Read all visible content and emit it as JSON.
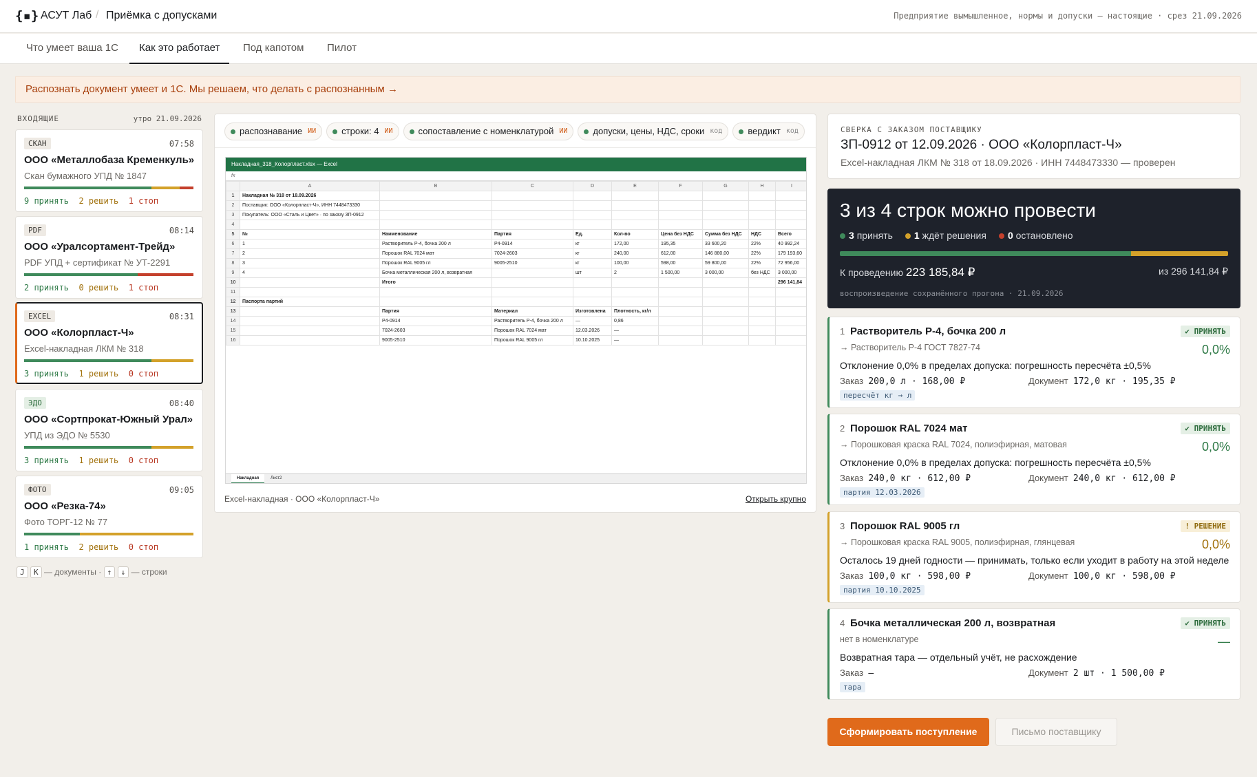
{
  "app": {
    "logo": "{▪}",
    "name": "АСУТ Лаб",
    "breadcrumb": "Приёмка с допусками",
    "note": "Предприятие вымышленное, нормы и допуски — настоящие · срез 21.09.2026"
  },
  "tabs": [
    {
      "label": "Что умеет ваша 1С",
      "active": false
    },
    {
      "label": "Как это работает",
      "active": true
    },
    {
      "label": "Под капотом",
      "active": false
    },
    {
      "label": "Пилот",
      "active": false
    }
  ],
  "banner": "Распознать документ умеет и 1С. Мы решаем, что делать с распознанным →",
  "inbox": {
    "title": "ВХОДЯЩИЕ",
    "time": "утро 21.09.2026",
    "docs": [
      {
        "tag": "СКАН",
        "time": "07:58",
        "title": "ООО «Металлобаза Кременкуль»",
        "sub": "Скан бумажного УПД № 1847",
        "accept": 0.75,
        "decide": 0.17,
        "stop": 0.08,
        "c_accept": "9 принять",
        "c_decide": "2 решить",
        "c_stop": "1 стоп"
      },
      {
        "tag": "PDF",
        "time": "08:14",
        "title": "ООО «Уралсортамент-Трейд»",
        "sub": "PDF УПД + сертификат № УТ-2291",
        "accept": 0.67,
        "decide": 0.0,
        "stop": 0.33,
        "c_accept": "2 принять",
        "c_decide": "0 решить",
        "c_stop": "1 стоп"
      },
      {
        "tag": "EXCEL",
        "time": "08:31",
        "title": "ООО «Колорпласт-Ч»",
        "sub": "Excel-накладная ЛКМ № 318",
        "accept": 0.75,
        "decide": 0.25,
        "stop": 0.0,
        "c_accept": "3 принять",
        "c_decide": "1 решить",
        "c_stop": "0 стоп"
      },
      {
        "tag": "ЭДО",
        "time": "08:40",
        "title": "ООО «Сортпрокат-Южный Урал»",
        "sub": "УПД из ЭДО № 5530",
        "accept": 0.75,
        "decide": 0.25,
        "stop": 0.0,
        "c_accept": "3 принять",
        "c_decide": "1 решить",
        "c_stop": "0 стоп"
      },
      {
        "tag": "ФОТО",
        "time": "09:05",
        "title": "ООО «Резка-74»",
        "sub": "Фото ТОРГ-12 № 77",
        "accept": 0.33,
        "decide": 0.67,
        "stop": 0.0,
        "c_accept": "1 принять",
        "c_decide": "2 решить",
        "c_stop": "0 стоп"
      }
    ],
    "hint": {
      "k1": "J",
      "k2": "K",
      "t1": "— документы ·",
      "k3": "↑",
      "k4": "↓",
      "t2": "— строки"
    }
  },
  "pipeline": {
    "chips": [
      {
        "label": "распознавание",
        "kind": "ИИ"
      },
      {
        "label": "строки: 4",
        "kind": "ИИ"
      },
      {
        "label": "сопоставление с номенклатурой",
        "kind": "ИИ"
      },
      {
        "label": "допуски, цены, НДС, сроки",
        "kind": "код"
      },
      {
        "label": "вердикт",
        "kind": "код"
      }
    ],
    "caption": "Excel-накладная · ООО «Колорпласт-Ч»",
    "open": "Открыть крупно"
  },
  "excel": {
    "title": "Накладная_318_Колорпласт.xlsx — Excel",
    "fx": "fx",
    "cols": [
      "",
      "A",
      "B",
      "C",
      "D",
      "E",
      "F",
      "G",
      "H",
      "I"
    ],
    "rows": [
      [
        "1",
        "Накладная № 318 от 18.09.2026",
        "",
        "",
        "",
        "",
        "",
        "",
        "",
        ""
      ],
      [
        "2",
        "Поставщик: ООО «Колорпласт-Ч», ИНН 7448473330",
        "",
        "",
        "",
        "",
        "",
        "",
        "",
        ""
      ],
      [
        "3",
        "Покупатель: ООО «Сталь и Цвет» · по заказу ЗП-0912",
        "",
        "",
        "",
        "",
        "",
        "",
        "",
        ""
      ],
      [
        "4",
        "",
        "",
        "",
        "",
        "",
        "",
        "",
        "",
        ""
      ],
      [
        "5",
        "№",
        "Наименование",
        "Партия",
        "Ед.",
        "Кол-во",
        "Цена без НДС",
        "Сумма без НДС",
        "НДС",
        "Всего"
      ],
      [
        "6",
        "1",
        "Растворитель Р-4, бочка 200 л",
        "Р4-0914",
        "кг",
        "172,00",
        "195,35",
        "33 600,20",
        "22%",
        "40 992,24"
      ],
      [
        "7",
        "2",
        "Порошок RAL 7024 мат",
        "7024-2603",
        "кг",
        "240,00",
        "612,00",
        "146 880,00",
        "22%",
        "179 193,60"
      ],
      [
        "8",
        "3",
        "Порошок RAL 9005 гл",
        "9005-2510",
        "кг",
        "100,00",
        "598,00",
        "59 800,00",
        "22%",
        "72 956,00"
      ],
      [
        "9",
        "4",
        "Бочка металлическая 200 л, возвратная",
        "",
        "шт",
        "2",
        "1 500,00",
        "3 000,00",
        "без НДС",
        "3 000,00"
      ],
      [
        "10",
        "",
        "Итого",
        "",
        "",
        "",
        "",
        "",
        "",
        "296 141,84"
      ],
      [
        "11",
        "",
        "",
        "",
        "",
        "",
        "",
        "",
        "",
        ""
      ],
      [
        "12",
        "Паспорта партий",
        "",
        "",
        "",
        "",
        "",
        "",
        "",
        ""
      ],
      [
        "13",
        "",
        "Партия",
        "Материал",
        "Изготовлена",
        "Плотность, кг/л",
        "",
        "",
        "",
        ""
      ],
      [
        "14",
        "",
        "Р4-0914",
        "Растворитель Р-4, бочка 200 л",
        "—",
        "0,86",
        "",
        "",
        "",
        ""
      ],
      [
        "15",
        "",
        "7024-2603",
        "Порошок RAL 7024 мат",
        "12.03.2026",
        "—",
        "",
        "",
        "",
        ""
      ],
      [
        "16",
        "",
        "9005-2510",
        "Порошок RAL 9005 гл",
        "10.10.2025",
        "—",
        "",
        "",
        "",
        ""
      ]
    ],
    "sheets": [
      "Накладная",
      "Лист2"
    ]
  },
  "sverka": {
    "label": "СВЕРКА С ЗАКАЗОМ ПОСТАВЩИКУ",
    "title": "ЗП-0912 от 12.09.2026 · ООО «Колорпласт-Ч»",
    "sub": "Excel-накладная ЛКМ № 318 от 18.09.2026 · ИНН 7448473330 — проверен"
  },
  "verdict": {
    "headline": "3 из 4 строк можно провести",
    "accepted_n": "3",
    "accepted_t": "принять",
    "waiting_n": "1",
    "waiting_t": "ждёт решения",
    "stopped_n": "0",
    "stopped_t": "остановлено",
    "accept_share": 0.75,
    "wait_share": 0.25,
    "sum_label": "К проведению",
    "sum": "223 185,84 ₽",
    "of": "из 296 141,84 ₽",
    "replay": "воспроизведение сохранённого прогона · 21.09.2026"
  },
  "lines": [
    {
      "n": "1",
      "title": "Растворитель Р-4, бочка 200 л",
      "badge": "✔ ПРИНЯТЬ",
      "status": "ok",
      "pct": "0,0%",
      "match": "→ Растворитель Р-4 ГОСТ 7827-74",
      "desc": "Отклонение 0,0% в пределах допуска: погрешность пересчёта ±0,5%",
      "order_l": "Заказ",
      "order": "200,0 л · 168,00 ₽",
      "doc_l": "Документ",
      "doc": "172,0 кг · 195,35 ₽",
      "tag": "пересчёт кг → л"
    },
    {
      "n": "2",
      "title": "Порошок RAL 7024 мат",
      "badge": "✔ ПРИНЯТЬ",
      "status": "ok",
      "pct": "0,0%",
      "match": "→ Порошковая краска RAL 7024, полиэфирная, матовая",
      "desc": "Отклонение 0,0% в пределах допуска: погрешность пересчёта ±0,5%",
      "order_l": "Заказ",
      "order": "240,0 кг · 612,00 ₽",
      "doc_l": "Документ",
      "doc": "240,0 кг · 612,00 ₽",
      "tag": "партия 12.03.2026"
    },
    {
      "n": "3",
      "title": "Порошок RAL 9005 гл",
      "badge": "! РЕШЕНИЕ",
      "status": "warn",
      "pct": "0,0%",
      "match": "→ Порошковая краска RAL 9005, полиэфирная, глянцевая",
      "desc": "Осталось 19 дней годности — принимать, только если уходит в работу на этой неделе",
      "order_l": "Заказ",
      "order": "100,0 кг · 598,00 ₽",
      "doc_l": "Документ",
      "doc": "100,0 кг · 598,00 ₽",
      "tag": "партия 10.10.2025"
    },
    {
      "n": "4",
      "title": "Бочка металлическая 200 л, возвратная",
      "badge": "✔ ПРИНЯТЬ",
      "status": "ok",
      "pct": "—",
      "match": "нет в номенклатуре",
      "desc": "Возвратная тара — отдельный учёт, не расхождение",
      "order_l": "Заказ",
      "order": "—",
      "doc_l": "Документ",
      "doc": "2 шт · 1 500,00 ₽",
      "tag": "тара"
    }
  ],
  "actions": {
    "primary": "Сформировать поступление",
    "secondary": "Письмо поставщику"
  },
  "colors": {
    "accent": "#e06a1b",
    "ok": "#3f8a5b",
    "warn": "#d3a12a",
    "stop": "#c4402c",
    "dark": "#1e222b"
  }
}
